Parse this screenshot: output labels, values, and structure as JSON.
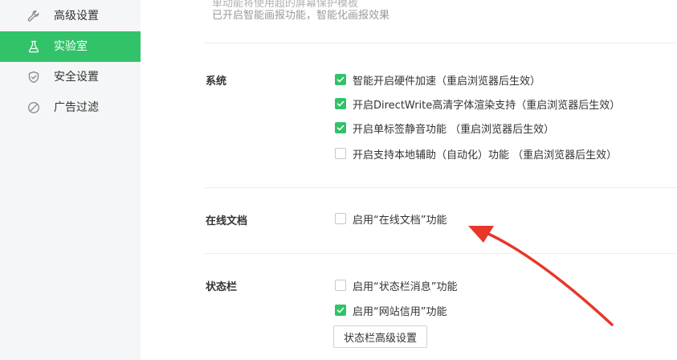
{
  "sidebar": {
    "items": [
      {
        "label": "高级设置",
        "icon": "wrench-icon"
      },
      {
        "label": "实验室",
        "icon": "flask-icon",
        "active": true
      },
      {
        "label": "安全设置",
        "icon": "shield-icon"
      },
      {
        "label": "广告过滤",
        "icon": "block-icon"
      }
    ]
  },
  "top_cutoff": {
    "line1": "单动能将使用超的屏幕保护模板",
    "line2": "已开启智能画报功能，智能化画报效果"
  },
  "sections": {
    "system": {
      "title": "系统",
      "options": [
        {
          "label": "智能开启硬件加速（重启浏览器后生效）",
          "checked": true
        },
        {
          "label": "开启DirectWrite高清字体渲染支持（重启浏览器后生效）",
          "checked": true
        },
        {
          "label": "开启单标签静音功能 （重启浏览器后生效）",
          "checked": true
        },
        {
          "label": "开启支持本地辅助（自动化）功能 （重启浏览器后生效）",
          "checked": false
        }
      ]
    },
    "online_docs": {
      "title": "在线文档",
      "options": [
        {
          "label": "启用“在线文档”功能",
          "checked": false
        }
      ]
    },
    "status_bar": {
      "title": "状态栏",
      "options": [
        {
          "label": "启用“状态栏消息”功能",
          "checked": false
        },
        {
          "label": "启用“网站信用”功能",
          "checked": true
        }
      ],
      "button_label": "状态栏高级设置"
    }
  },
  "colors": {
    "accent": "#31c26a",
    "annotation_arrow": "#e8362a"
  }
}
